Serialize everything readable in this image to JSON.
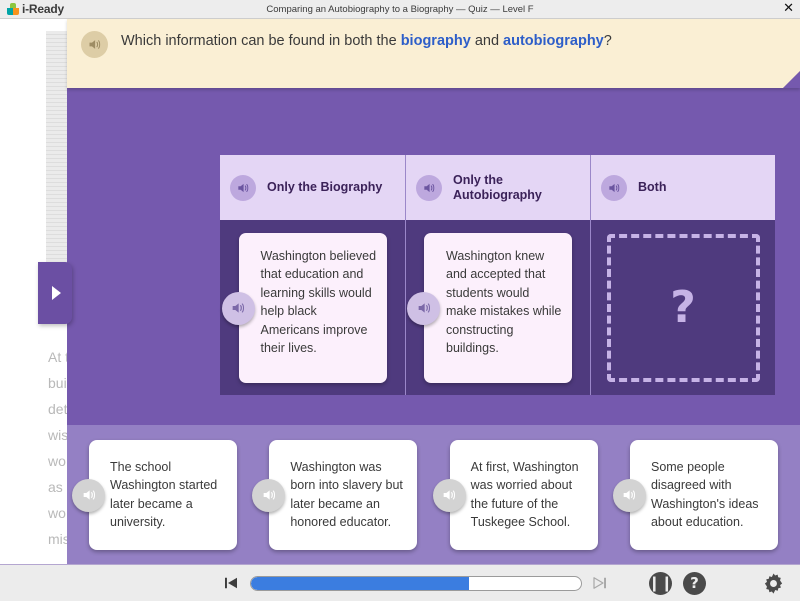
{
  "titlebar": {
    "logo_text": "i-Ready",
    "title": "Comparing an Autobiography to a Biography — Quiz — Level F",
    "close_label": "✕"
  },
  "passage": {
    "lines": [
      "At t",
      "bui",
      "det",
      "wis",
      "wo",
      "as",
      "wo",
      "mis"
    ],
    "expand_tab_label": "▶"
  },
  "question": {
    "part1": "Which information can be found in both the ",
    "link1": "biography",
    "part2": " and ",
    "link2": "autobiography",
    "part3": "?",
    "link_color": "#2d5ec9"
  },
  "columns": [
    {
      "id": "only-biography",
      "header": "Only the Biography",
      "card": "Washington believed that education and learning skills would help black Americans improve their lives.",
      "empty": false
    },
    {
      "id": "only-autobiography",
      "header": "Only the Autobiography",
      "card": "Washington knew and accepted that students would make mistakes while constructing buildings.",
      "empty": false
    },
    {
      "id": "both",
      "header": "Both",
      "card": "",
      "empty": true,
      "placeholder": "?"
    }
  ],
  "tray_cards": [
    "The school Washington started later became a university.",
    "Washington was born into slavery but later became an honored educator.",
    "At first, Washington was worried about the future of the Tuskegee School.",
    "Some people disagreed with Washington's ideas about education."
  ],
  "toolbar": {
    "progress_percent": 66,
    "pause_label": "❙❙",
    "help_label": "?"
  },
  "colors": {
    "stage": "#7559AE",
    "board_panel": "#4F3A7E",
    "tray": "#9480C4",
    "banner": "#FAEFD4",
    "column_header": "#E4D6F5",
    "progress_fill": "#3b7de0"
  }
}
